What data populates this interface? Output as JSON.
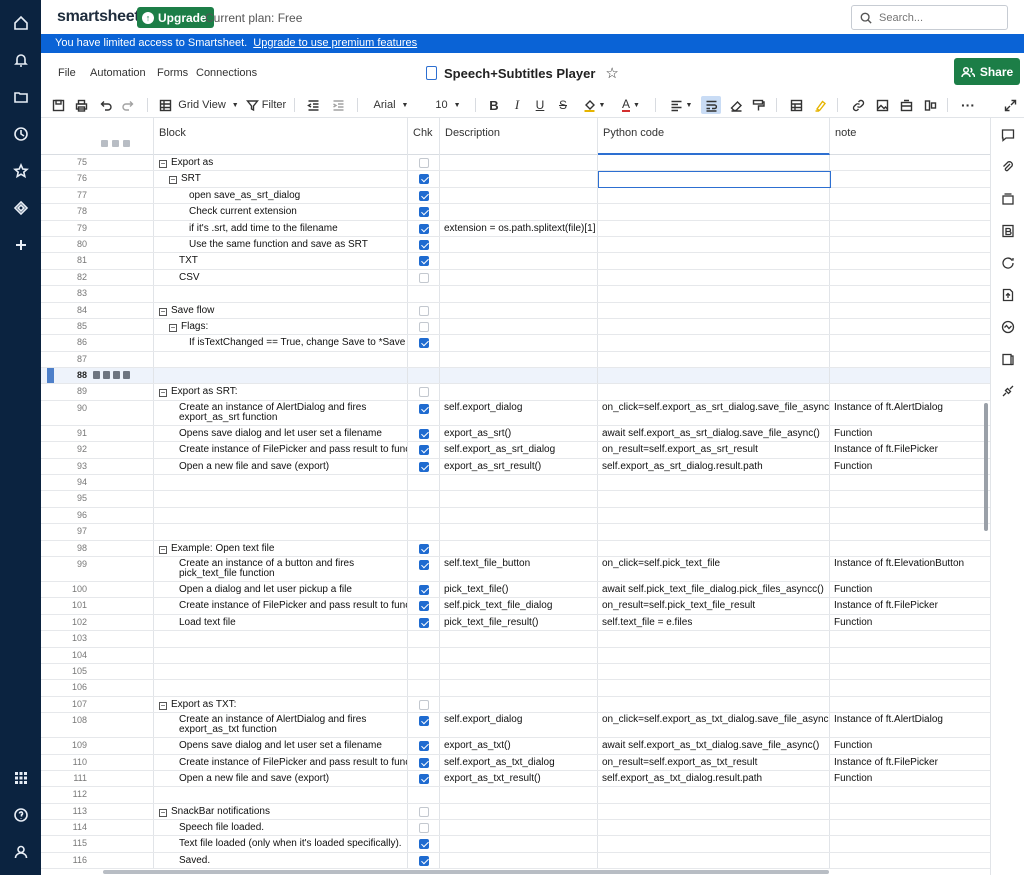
{
  "header": {
    "logo": "smartsheet",
    "upgrade_label": "Upgrade",
    "plan_text": "Current plan: Free",
    "search_placeholder": "Search..."
  },
  "banner": {
    "text": "You have limited access to Smartsheet.",
    "link": "Upgrade to use premium features"
  },
  "menu": {
    "items": [
      "File",
      "Automation",
      "Forms",
      "Connections"
    ],
    "sheet_title": "Speech+Subtitles Player",
    "share_label": "Share"
  },
  "toolbar": {
    "view_label": "Grid View",
    "filter_label": "Filter",
    "font": "Arial",
    "size": "10"
  },
  "columns": {
    "block": "Block",
    "chk": "Chk",
    "description": "Description",
    "python_code": "Python code",
    "note": "note"
  },
  "colors": {
    "nav_bg": "#0b2340",
    "banner_bg": "#0a63d6",
    "brand_green": "#1c7e47",
    "check_blue": "#1f6bd0"
  },
  "rows": [
    {
      "n": "75",
      "indent": 0,
      "exp": true,
      "block": "Export as",
      "chk": false,
      "desc": "",
      "py": "",
      "note": ""
    },
    {
      "n": "76",
      "indent": 1,
      "exp": true,
      "block": "SRT",
      "chk": true,
      "desc": "",
      "py": "",
      "note": "",
      "active": true
    },
    {
      "n": "77",
      "indent": 3,
      "exp": false,
      "block": "open save_as_srt_dialog",
      "chk": true,
      "desc": "",
      "py": "",
      "note": ""
    },
    {
      "n": "78",
      "indent": 3,
      "exp": false,
      "block": "Check current extension",
      "chk": true,
      "desc": "",
      "py": "",
      "note": ""
    },
    {
      "n": "79",
      "indent": 3,
      "exp": false,
      "block": "if it's .srt, add time to the filename",
      "chk": true,
      "desc": "extension = os.path.splitext(file)[1]",
      "py": "",
      "note": ""
    },
    {
      "n": "80",
      "indent": 3,
      "exp": false,
      "block": "Use the same function and save as SRT",
      "chk": true,
      "desc": "",
      "py": "",
      "note": ""
    },
    {
      "n": "81",
      "indent": 2,
      "exp": false,
      "block": "TXT",
      "chk": true,
      "desc": "",
      "py": "",
      "note": ""
    },
    {
      "n": "82",
      "indent": 2,
      "exp": false,
      "block": "CSV",
      "chk": false,
      "desc": "",
      "py": "",
      "note": ""
    },
    {
      "n": "83",
      "indent": 0,
      "exp": false,
      "block": "",
      "chk": null,
      "desc": "",
      "py": "",
      "note": ""
    },
    {
      "n": "84",
      "indent": 0,
      "exp": true,
      "block": "Save flow",
      "chk": false,
      "desc": "",
      "py": "",
      "note": ""
    },
    {
      "n": "85",
      "indent": 1,
      "exp": true,
      "block": "Flags:",
      "chk": false,
      "desc": "",
      "py": "",
      "note": ""
    },
    {
      "n": "86",
      "indent": 3,
      "exp": false,
      "block": "If isTextChanged == True, change Save to *Save",
      "chk": true,
      "desc": "",
      "py": "",
      "note": ""
    },
    {
      "n": "87",
      "indent": 0,
      "exp": false,
      "block": "",
      "chk": null,
      "desc": "",
      "py": "",
      "note": ""
    },
    {
      "n": "88",
      "indent": 0,
      "exp": false,
      "block": "",
      "chk": null,
      "desc": "",
      "py": "",
      "note": "",
      "highlight": true
    },
    {
      "n": "89",
      "indent": 0,
      "exp": true,
      "block": "Export as SRT:",
      "chk": false,
      "desc": "",
      "py": "",
      "note": ""
    },
    {
      "n": "90",
      "indent": 2,
      "exp": false,
      "block": "Create an instance of AlertDialog and fires export_as_srt function",
      "chk": true,
      "desc": "self.export_dialog",
      "py": "on_click=self.export_as_srt_dialog.save_file_async",
      "note": "Instance of ft.AlertDialog",
      "tall": true
    },
    {
      "n": "91",
      "indent": 2,
      "exp": false,
      "block": "Opens save dialog and let user set a filename",
      "chk": true,
      "desc": "export_as_srt()",
      "py": "await self.export_as_srt_dialog.save_file_async()",
      "note": "Function"
    },
    {
      "n": "92",
      "indent": 2,
      "exp": false,
      "block": "Create instance of FilePicker and pass result to function",
      "chk": true,
      "desc": "self.export_as_srt_dialog",
      "py": "on_result=self.export_as_srt_result",
      "note": "Instance of ft.FilePicker"
    },
    {
      "n": "93",
      "indent": 2,
      "exp": false,
      "block": "Open a new file and save (export)",
      "chk": true,
      "desc": "export_as_srt_result()",
      "py": "self.export_as_srt_dialog.result.path",
      "note": "Function"
    },
    {
      "n": "94",
      "indent": 0,
      "exp": false,
      "block": "",
      "chk": null,
      "desc": "",
      "py": "",
      "note": ""
    },
    {
      "n": "95",
      "indent": 0,
      "exp": false,
      "block": "",
      "chk": null,
      "desc": "",
      "py": "",
      "note": ""
    },
    {
      "n": "96",
      "indent": 0,
      "exp": false,
      "block": "",
      "chk": null,
      "desc": "",
      "py": "",
      "note": ""
    },
    {
      "n": "97",
      "indent": 0,
      "exp": false,
      "block": "",
      "chk": null,
      "desc": "",
      "py": "",
      "note": ""
    },
    {
      "n": "98",
      "indent": 0,
      "exp": true,
      "block": "Example: Open text file",
      "chk": true,
      "desc": "",
      "py": "",
      "note": ""
    },
    {
      "n": "99",
      "indent": 2,
      "exp": false,
      "block": "Create an instance of a button and fires pick_text_file function",
      "chk": true,
      "desc": "self.text_file_button",
      "py": "on_click=self.pick_text_file",
      "note": "Instance of ft.ElevationButton",
      "tall": true
    },
    {
      "n": "100",
      "indent": 2,
      "exp": false,
      "block": "Open a dialog and let user pickup a file",
      "chk": true,
      "desc": "pick_text_file()",
      "py": "await self.pick_text_file_dialog.pick_files_asyncc()",
      "note": "Function"
    },
    {
      "n": "101",
      "indent": 2,
      "exp": false,
      "block": "Create instance of FilePicker and pass result to function",
      "chk": true,
      "desc": "self.pick_text_file_dialog",
      "py": "on_result=self.pick_text_file_result",
      "note": "Instance of ft.FilePicker"
    },
    {
      "n": "102",
      "indent": 2,
      "exp": false,
      "block": "Load text file",
      "chk": true,
      "desc": "pick_text_file_result()",
      "py": "self.text_file = e.files",
      "note": "Function"
    },
    {
      "n": "103",
      "indent": 0,
      "exp": false,
      "block": "",
      "chk": null,
      "desc": "",
      "py": "",
      "note": ""
    },
    {
      "n": "104",
      "indent": 0,
      "exp": false,
      "block": "",
      "chk": null,
      "desc": "",
      "py": "",
      "note": ""
    },
    {
      "n": "105",
      "indent": 0,
      "exp": false,
      "block": "",
      "chk": null,
      "desc": "",
      "py": "",
      "note": ""
    },
    {
      "n": "106",
      "indent": 0,
      "exp": false,
      "block": "",
      "chk": null,
      "desc": "",
      "py": "",
      "note": ""
    },
    {
      "n": "107",
      "indent": 0,
      "exp": true,
      "block": "Export as TXT:",
      "chk": false,
      "desc": "",
      "py": "",
      "note": ""
    },
    {
      "n": "108",
      "indent": 2,
      "exp": false,
      "block": "Create an instance of AlertDialog and fires export_as_txt function",
      "chk": true,
      "desc": "self.export_dialog",
      "py": "on_click=self.export_as_txt_dialog.save_file_async",
      "note": "Instance of ft.AlertDialog",
      "tall": true
    },
    {
      "n": "109",
      "indent": 2,
      "exp": false,
      "block": "Opens save dialog and let user set a filename",
      "chk": true,
      "desc": "export_as_txt()",
      "py": "await self.export_as_txt_dialog.save_file_async()",
      "note": "Function"
    },
    {
      "n": "110",
      "indent": 2,
      "exp": false,
      "block": "Create instance of FilePicker and pass result to function",
      "chk": true,
      "desc": "self.export_as_txt_dialog",
      "py": "on_result=self.export_as_txt_result",
      "note": "Instance of ft.FilePicker"
    },
    {
      "n": "111",
      "indent": 2,
      "exp": false,
      "block": "Open a new file and save (export)",
      "chk": true,
      "desc": "export_as_txt_result()",
      "py": "self.export_as_txt_dialog.result.path",
      "note": "Function"
    },
    {
      "n": "112",
      "indent": 0,
      "exp": false,
      "block": "",
      "chk": null,
      "desc": "",
      "py": "",
      "note": ""
    },
    {
      "n": "113",
      "indent": 0,
      "exp": true,
      "block": "SnackBar notifications",
      "chk": false,
      "desc": "",
      "py": "",
      "note": ""
    },
    {
      "n": "114",
      "indent": 2,
      "exp": false,
      "block": "Speech file loaded.",
      "chk": false,
      "desc": "",
      "py": "",
      "note": ""
    },
    {
      "n": "115",
      "indent": 2,
      "exp": false,
      "block": "Text file loaded (only when it's loaded specifically).",
      "chk": true,
      "desc": "",
      "py": "",
      "note": ""
    },
    {
      "n": "116",
      "indent": 2,
      "exp": false,
      "block": "Saved.",
      "chk": true,
      "desc": "",
      "py": "",
      "note": ""
    }
  ]
}
